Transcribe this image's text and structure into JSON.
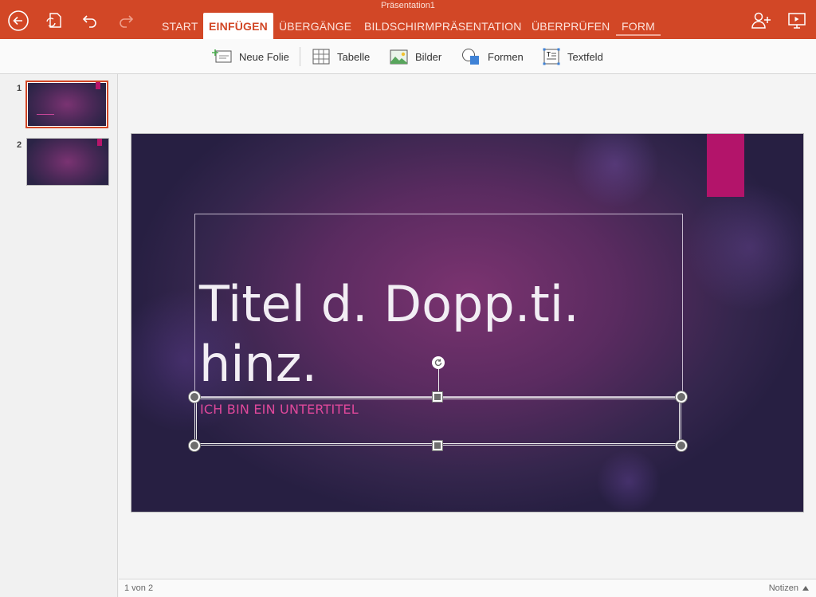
{
  "app": {
    "document_title": "Präsentation1",
    "accent_color": "#d24726"
  },
  "ribbon": {
    "tabs": [
      {
        "label": "START"
      },
      {
        "label": "EINFÜGEN",
        "active": true
      },
      {
        "label": "ÜBERGÄNGE"
      },
      {
        "label": "BILDSCHIRMPRÄSENTATION"
      },
      {
        "label": "ÜBERPRÜFEN"
      },
      {
        "label": "FORM"
      }
    ],
    "icons": {
      "back": "back-arrow-icon",
      "sync": "sync-file-icon",
      "undo": "undo-icon",
      "redo": "redo-icon",
      "share": "add-person-icon",
      "present": "present-icon"
    }
  },
  "commands": [
    {
      "label": "Neue Folie",
      "icon": "new-slide-icon"
    },
    {
      "label": "Tabelle",
      "icon": "table-icon"
    },
    {
      "label": "Bilder",
      "icon": "picture-icon"
    },
    {
      "label": "Formen",
      "icon": "shapes-icon"
    },
    {
      "label": "Textfeld",
      "icon": "textbox-icon"
    }
  ],
  "thumbnails": [
    {
      "number": "1",
      "selected": true
    },
    {
      "number": "2",
      "selected": false
    }
  ],
  "slide": {
    "title": "Titel d. Dopp.ti. hinz.",
    "subtitle": "ICH BIN EIN UNTERTITEL",
    "title_color": "#f2eef4",
    "subtitle_color": "#e0489b",
    "tag_color": "#b3146a"
  },
  "status": {
    "page": "1 von 2",
    "notes": "Notizen"
  }
}
